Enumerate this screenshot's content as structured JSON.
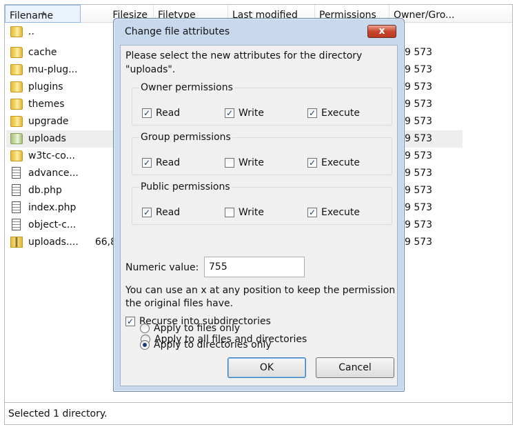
{
  "columns": {
    "filename": "Filename",
    "filesize": "Filesize",
    "filetype": "Filetype",
    "lastmod": "Last modified",
    "permissions": "Permissions",
    "owner": "Owner/Gro..."
  },
  "files": [
    {
      "name": "..",
      "icon": "folder-icon",
      "size": "",
      "owner": ""
    },
    {
      "name": "cache",
      "icon": "folder-icon",
      "size": "",
      "owner": "9 573"
    },
    {
      "name": "mu-plug...",
      "icon": "folder-icon",
      "size": "",
      "owner": "9 573"
    },
    {
      "name": "plugins",
      "icon": "folder-icon",
      "size": "",
      "owner": "9 573"
    },
    {
      "name": "themes",
      "icon": "folder-icon",
      "size": "",
      "owner": "9 573"
    },
    {
      "name": "upgrade",
      "icon": "folder-icon",
      "size": "",
      "owner": "9 573"
    },
    {
      "name": "uploads",
      "icon": "folder-icon",
      "size": "",
      "owner": "9 573"
    },
    {
      "name": "w3tc-co...",
      "icon": "folder-icon",
      "size": "",
      "owner": "9 573"
    },
    {
      "name": "advance...",
      "icon": "file-icon",
      "size": "",
      "owner": "9 573"
    },
    {
      "name": "db.php",
      "icon": "file-icon",
      "size": "",
      "owner": "9 573"
    },
    {
      "name": "index.php",
      "icon": "file-icon",
      "size": "",
      "owner": "9 573"
    },
    {
      "name": "object-c...",
      "icon": "file-icon",
      "size": "",
      "owner": "9 573"
    },
    {
      "name": "uploads....",
      "icon": "zip-icon",
      "size": "66,8",
      "owner": "9 573"
    }
  ],
  "status_bar": "Selected 1 directory.",
  "dialog": {
    "title": "Change file attributes",
    "close_label": "x",
    "description": "Please select the new attributes for the directory \"uploads\".",
    "groups": [
      {
        "title": "Owner permissions",
        "read": "Read",
        "write": "Write",
        "execute": "Execute",
        "read_checked": true,
        "write_checked": true,
        "execute_checked": true
      },
      {
        "title": "Group permissions",
        "read": "Read",
        "write": "Write",
        "execute": "Execute",
        "read_checked": true,
        "write_checked": false,
        "execute_checked": true
      },
      {
        "title": "Public permissions",
        "read": "Read",
        "write": "Write",
        "execute": "Execute",
        "read_checked": true,
        "write_checked": false,
        "execute_checked": true
      }
    ],
    "numeric_label": "Numeric value:",
    "numeric_value": "755",
    "hint": "You can use an x at any position to keep the permission the original files have.",
    "recurse_label": "Recurse into subdirectories",
    "recurse_checked": true,
    "radio_options": [
      {
        "label": "Apply to all files and directories",
        "selected": false
      },
      {
        "label": "Apply to files only",
        "selected": false
      },
      {
        "label": "Apply to directories only",
        "selected": true
      }
    ],
    "ok_label": "OK",
    "cancel_label": "Cancel"
  },
  "colors": {
    "dialog_frame": "#c8d9ee",
    "close_button": "#c9462c",
    "selected_row": "#eeeeee",
    "check_mark": "#1e3f7a"
  }
}
